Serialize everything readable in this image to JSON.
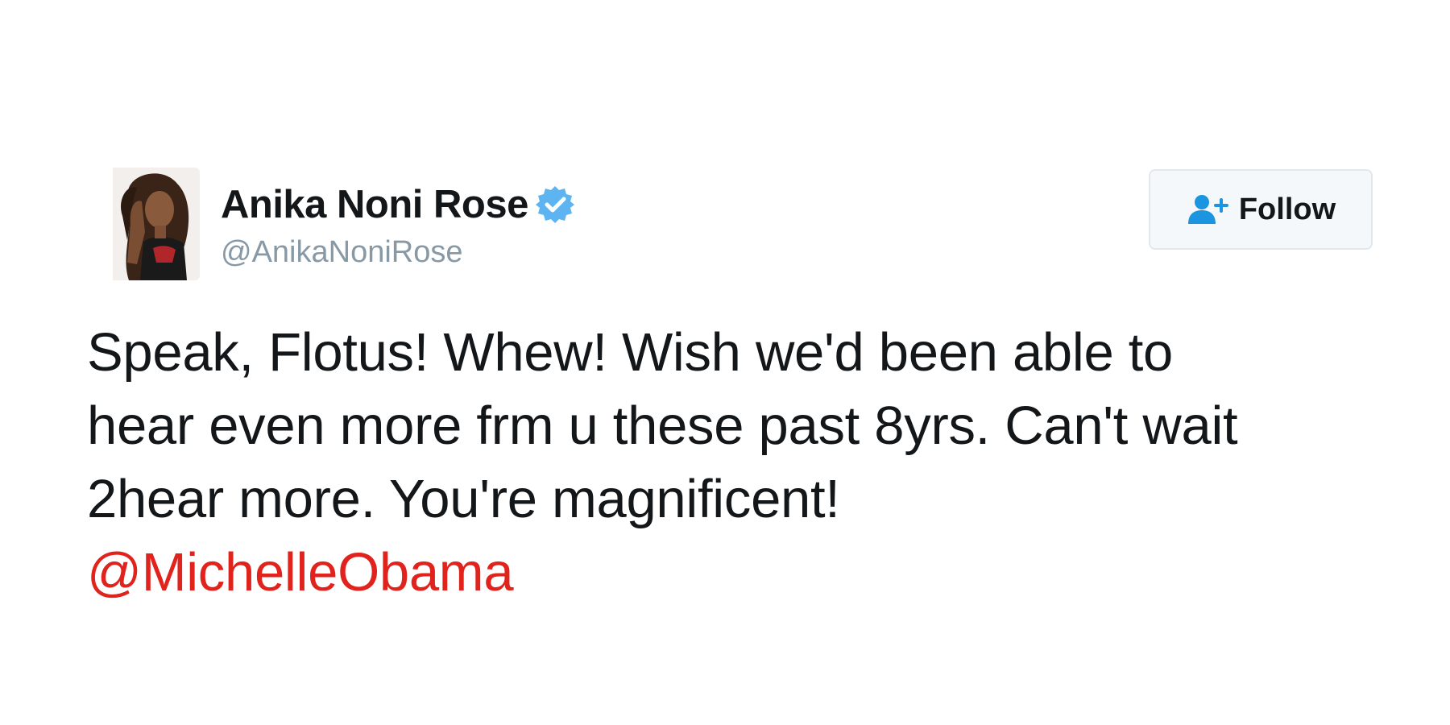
{
  "tweet": {
    "author": {
      "display_name": "Anika Noni Rose",
      "handle": "@AnikaNoniRose",
      "verified": true,
      "verified_icon": "verified-badge-icon",
      "avatar_icon": "avatar"
    },
    "follow_button": {
      "label": "Follow",
      "icon": "add-user-icon"
    },
    "text_lines": [
      "Speak, Flotus! Whew! Wish we'd been able to",
      "hear even more frm u these past 8yrs. Can't wait",
      "2hear more. You're magnificent!"
    ],
    "mention": "@MichelleObama"
  },
  "colors": {
    "text": "#14171a",
    "handle": "#8899a6",
    "verified": "#1da1f2",
    "mention": "#e0231c",
    "button_border": "#e1e8ed",
    "button_bg": "#f5f8fa"
  }
}
